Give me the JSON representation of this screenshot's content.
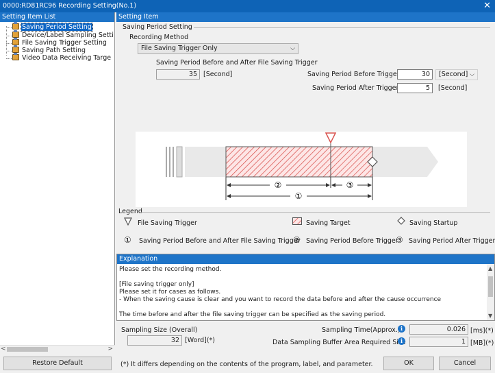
{
  "window": {
    "title": "0000:RD81RC96 Recording Setting(No.1)",
    "close_glyph": "✕"
  },
  "left_panel": {
    "header": "Setting Item List",
    "items": [
      {
        "label": "Saving Period Setting",
        "selected": true
      },
      {
        "label": "Device/Label Sampling Setti",
        "selected": false
      },
      {
        "label": "File Saving Trigger Setting",
        "selected": false
      },
      {
        "label": "Saving Path Setting",
        "selected": false
      },
      {
        "label": "Video Data Receiving Targe",
        "selected": false
      }
    ]
  },
  "right_panel": {
    "header": "Setting Item",
    "group_title": "Saving Period Setting",
    "recording_method_label": "Recording Method",
    "recording_method_value": "File Saving Trigger Only",
    "before_after_label": "Saving Period Before and After File Saving Trigger",
    "before_after_value": "35",
    "before_after_unit": "[Second]",
    "before_trigger_label": "Saving Period Before Trigger",
    "before_trigger_value": "30",
    "before_trigger_unit": "[Second]",
    "after_trigger_label": "Saving Period After Trigger",
    "after_trigger_value": "5",
    "after_trigger_unit": "[Second]"
  },
  "diagram": {
    "label_1": "①",
    "label_2": "②",
    "label_3": "③"
  },
  "legend": {
    "title": "Legend",
    "trigger": "File Saving Trigger",
    "target": "Saving Target",
    "startup": "Saving Startup",
    "item1_num": "①",
    "item1": "Saving Period Before and After File Saving Trigger",
    "item2_num": "②",
    "item2": "Saving Period Before Trigger",
    "item3_num": "③",
    "item3": "Saving Period After Trigger"
  },
  "explanation": {
    "header": "Explanation",
    "text": "Please set the recording method.\n\n[File saving trigger only]\nPlease set it for cases as follows.\n- When the saving cause is clear and you want to record the data before and after the cause occurrence\n\nThe time before and after the file saving trigger can be specified as the saving period."
  },
  "sampling": {
    "size_label": "Sampling Size (Overall)",
    "size_value": "32",
    "size_unit": "[Word](*)",
    "time_label": "Sampling Time(Approx.)",
    "time_value": "0.026",
    "time_unit": "[ms](*)",
    "buffer_label": "Data Sampling Buffer Area Required Size",
    "buffer_value": "1",
    "buffer_unit": "[MB](*)"
  },
  "footer": {
    "restore_default": "Restore Default",
    "note": "(*) It differs depending on the contents of the program, label, and parameter.",
    "ok": "OK",
    "cancel": "Cancel"
  },
  "colors": {
    "title_bar": "#0e63b6",
    "panel_header": "#1e74c8",
    "hatch": "#d9534f"
  }
}
